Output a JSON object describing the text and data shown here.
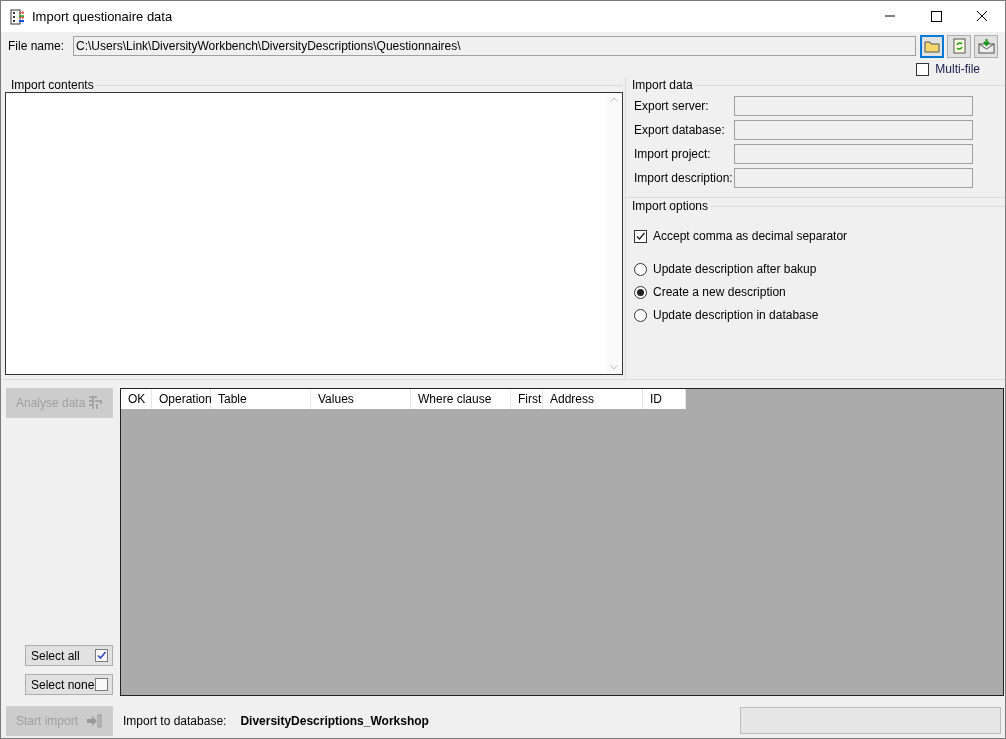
{
  "window": {
    "title": "Import questionaire data"
  },
  "file": {
    "label": "File name:",
    "value": "C:\\Users\\Link\\DiversityWorkbench\\DiversityDescriptions\\Questionnaires\\"
  },
  "multi_file": {
    "label": "Multi-file",
    "checked": false
  },
  "import_contents": {
    "title": "Import contents"
  },
  "import_data": {
    "title": "Import data",
    "fields": [
      {
        "label": "Export server:"
      },
      {
        "label": "Export database:"
      },
      {
        "label": "Import project:"
      },
      {
        "label": "Import description:"
      }
    ]
  },
  "import_options": {
    "title": "Import options",
    "checkbox": {
      "label": "Accept comma as decimal separator",
      "checked": true
    },
    "radios": [
      {
        "label": "Update description after bakup",
        "selected": false
      },
      {
        "label": "Create a new description",
        "selected": true
      },
      {
        "label": "Update description in database",
        "selected": false
      }
    ]
  },
  "analyse_button": {
    "label": "Analyse data",
    "disabled": true
  },
  "grid": {
    "columns": [
      "OK",
      "Operation",
      "Table",
      "Values",
      "Where clause",
      "First",
      "Address",
      "ID"
    ]
  },
  "select_all": {
    "label": "Select all",
    "checked": true
  },
  "select_none": {
    "label": "Select none",
    "checked": false
  },
  "start_button": {
    "label": "Start import",
    "disabled": true
  },
  "footer": {
    "label": "Import to database:",
    "database": "DiversityDescriptions_Workshop"
  }
}
